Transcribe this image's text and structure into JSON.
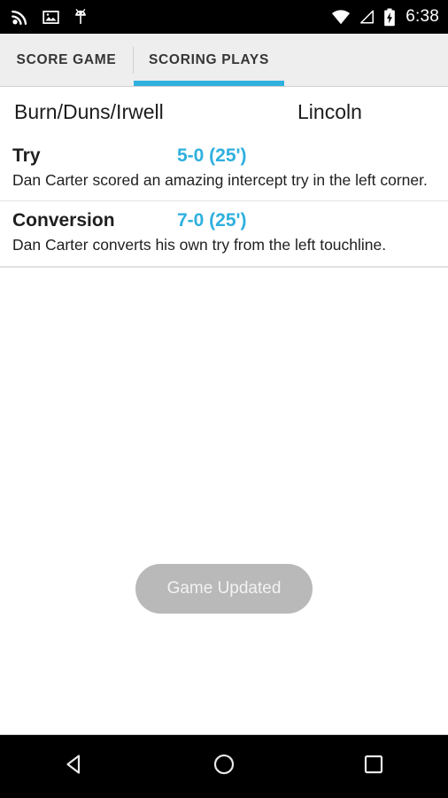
{
  "status_bar": {
    "time": "6:38",
    "left_icons": [
      {
        "name": "cast-rss-icon",
        "label": "cast"
      },
      {
        "name": "screenshot-image-icon",
        "label": "screenshot"
      },
      {
        "name": "android-debug-icon",
        "label": "usb-debugging"
      }
    ],
    "right_icons": [
      {
        "name": "wifi-icon",
        "label": "wifi-full"
      },
      {
        "name": "cell-signal-icon",
        "label": "signal-none"
      },
      {
        "name": "battery-charging-icon",
        "label": "battery-charging"
      }
    ],
    "background": "#000000",
    "foreground": "#ffffff"
  },
  "tabs": [
    {
      "label": "SCORE GAME",
      "active": false
    },
    {
      "label": "SCORING PLAYS",
      "active": true
    }
  ],
  "accent_color": "#2fb0de",
  "teams": {
    "home": "Burn/Duns/Irwell",
    "away": "Lincoln"
  },
  "scoring_plays": [
    {
      "type": "Try",
      "score": "5-0 (25')",
      "description": "Dan Carter scored an amazing intercept try in the left corner."
    },
    {
      "type": "Conversion",
      "score": "7-0 (25')",
      "description": "Dan Carter converts his own try from the left touchline."
    }
  ],
  "toast": {
    "message": "Game Updated"
  },
  "nav_bar": {
    "back": "back-button",
    "home": "home-button",
    "recents": "recents-button"
  }
}
